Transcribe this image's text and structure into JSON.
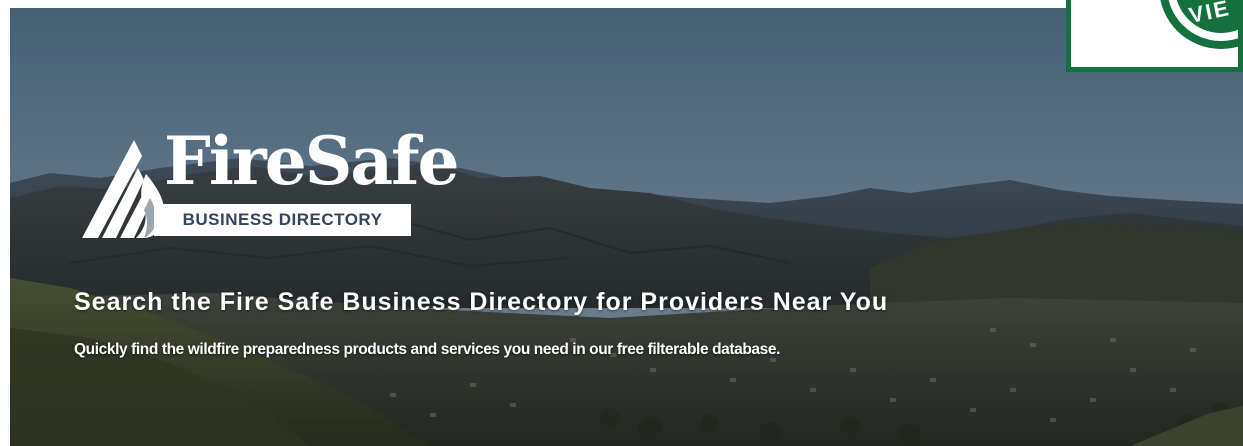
{
  "logo": {
    "brand": "FireSafe",
    "subtitle": "BUSINESS DIRECTORY"
  },
  "hero": {
    "headline": "Search the Fire Safe Business Directory for Providers Near You",
    "subline": "Quickly find the wildfire preparedness products and services you need in our free filterable database."
  },
  "badge": {
    "partial_text": "VIE"
  },
  "icons": {
    "logo_mark": "mountain-flame-icon",
    "badge_mark": "seal-icon"
  },
  "colors": {
    "logo_subtitle": "#34455d",
    "badge_green": "#14703c",
    "sky": "#6e8aa6"
  }
}
